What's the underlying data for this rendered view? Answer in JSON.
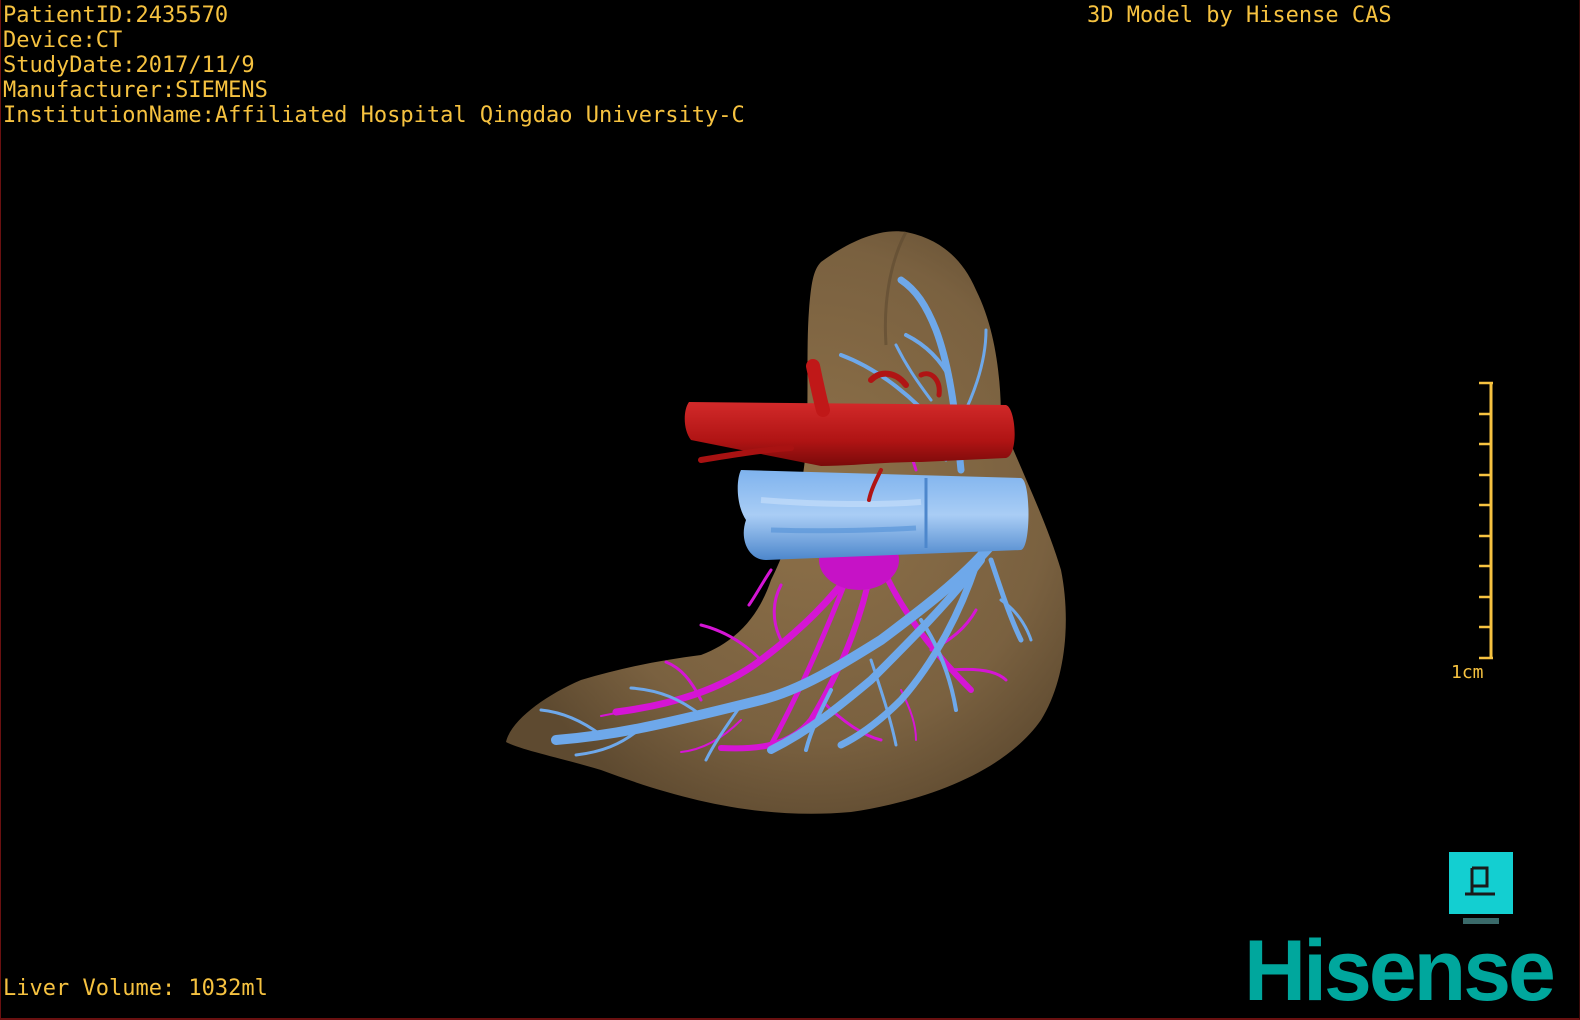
{
  "overlay": {
    "patient_id": "PatientID:2435570",
    "device": "Device:CT",
    "study_date": "StudyDate:2017/11/9",
    "manufacturer": "Manufacturer:SIEMENS",
    "institution": "InstitutionName:Affiliated Hospital Qingdao University-C",
    "credit": "3D Model by Hisense CAS",
    "liver_volume": "Liver Volume: 1032ml"
  },
  "scale_bar": {
    "label": "1cm"
  },
  "logo": {
    "text": "Hisense"
  },
  "colors": {
    "overlay_text": "#f6c240",
    "liver": "#8b7048",
    "artery": "#c01818",
    "portal_vein": "#6ea8ea",
    "hepatic_vein": "#d515d5",
    "brand": "#00a79d"
  },
  "icons": {
    "view_button": "pin-icon"
  }
}
